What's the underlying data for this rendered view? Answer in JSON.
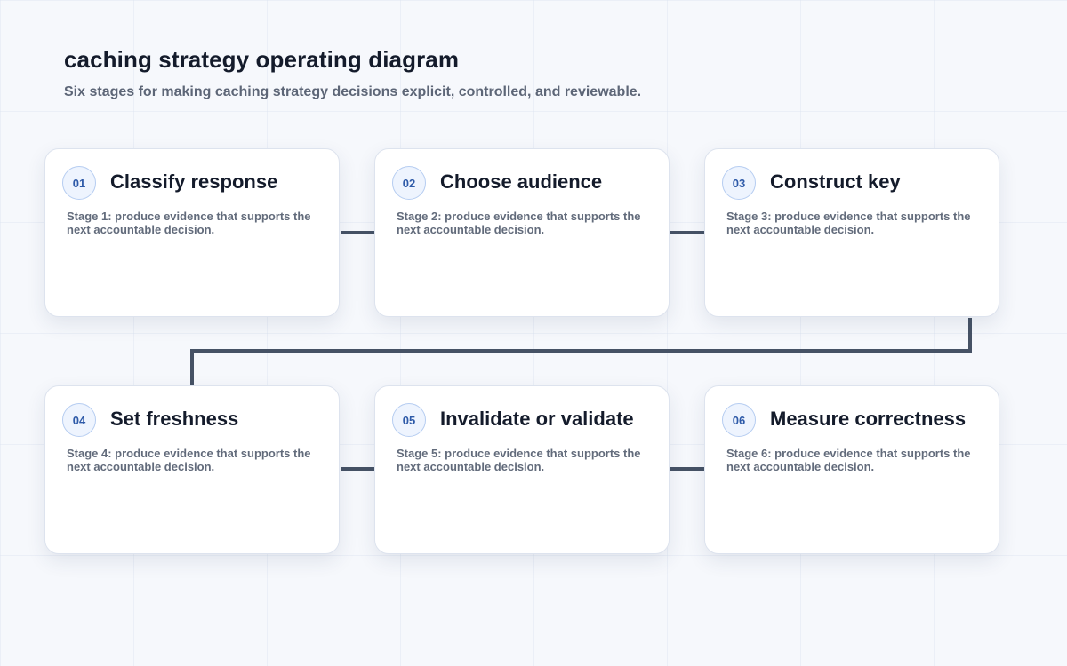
{
  "header": {
    "title": "caching strategy operating diagram",
    "subtitle": "Six stages for making caching strategy decisions explicit, controlled, and reviewable."
  },
  "stages": [
    {
      "number": "01",
      "title": "Classify response",
      "description": "Stage 1: produce evidence that supports the next accountable decision."
    },
    {
      "number": "02",
      "title": "Choose audience",
      "description": "Stage 2: produce evidence that supports the next accountable decision."
    },
    {
      "number": "03",
      "title": "Construct key",
      "description": "Stage 3: produce evidence that supports the next accountable decision."
    },
    {
      "number": "04",
      "title": "Set freshness",
      "description": "Stage 4: produce evidence that supports the next accountable decision."
    },
    {
      "number": "05",
      "title": "Invalidate or validate",
      "description": "Stage 5: produce evidence that supports the next accountable decision."
    },
    {
      "number": "06",
      "title": "Measure correctness",
      "description": "Stage 6: produce evidence that supports the next accountable decision."
    }
  ],
  "colors": {
    "connector": "#465265",
    "badge_text": "#2e5aa8",
    "badge_border": "#b6cdf1",
    "badge_fill": "#eef4fe"
  }
}
